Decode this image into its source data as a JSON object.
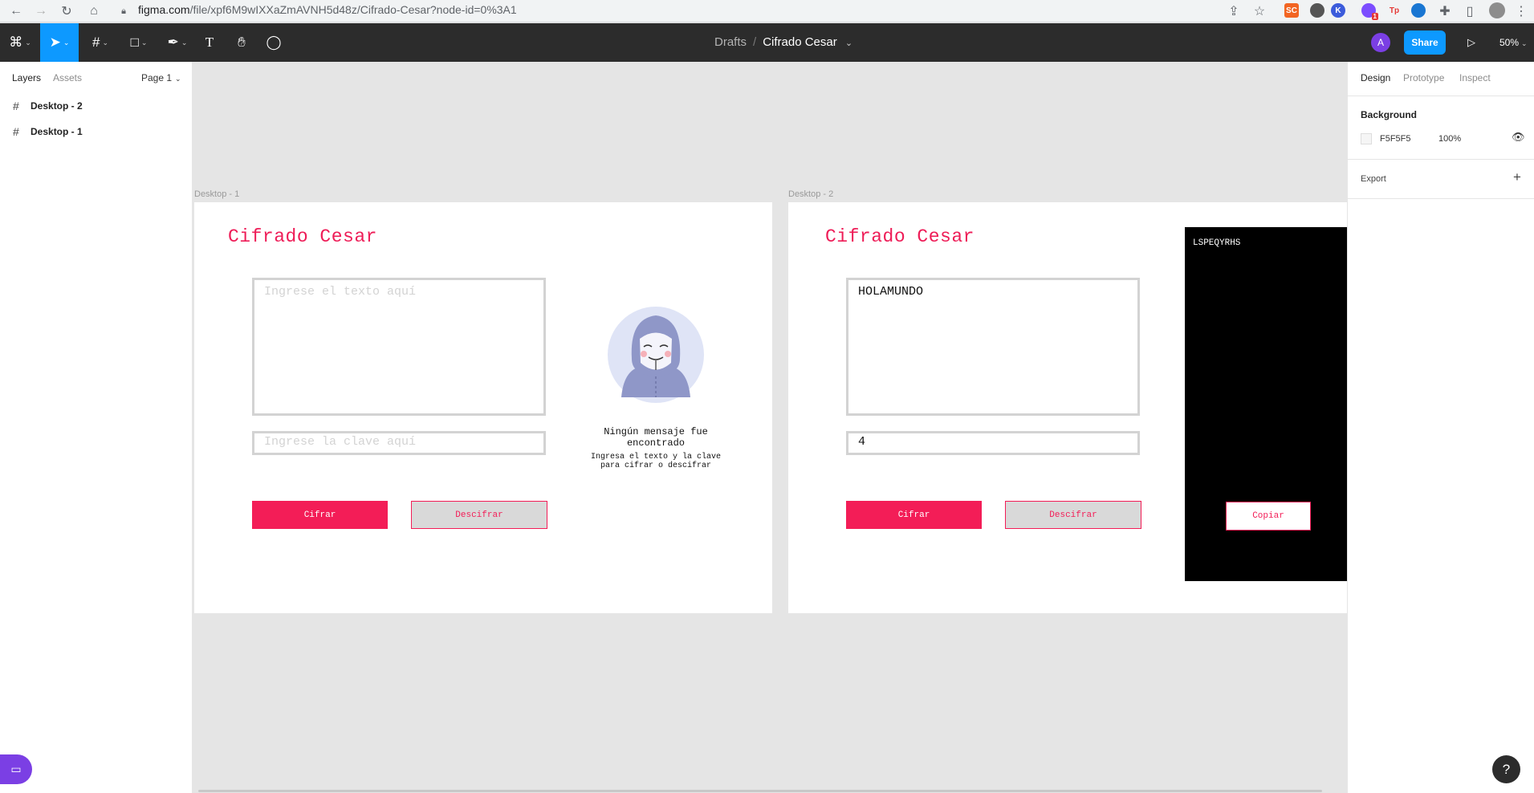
{
  "browser": {
    "url_host": "figma.com",
    "url_path": "/file/xpf6M9wIXXaZmAVNH5d48z/Cifrado-Cesar?node-id=0%3A1",
    "ext_sc": "SC",
    "ext_k": "K",
    "ext_badge": "1",
    "ext_tp": "Tp"
  },
  "toolbar": {
    "drafts": "Drafts",
    "separator": "/",
    "file_name": "Cifrado Cesar",
    "file_caret": "⌄",
    "avatar_initial": "A",
    "share_label": "Share",
    "zoom": "50%"
  },
  "left_panel": {
    "tab_layers": "Layers",
    "tab_assets": "Assets",
    "page_select": "Page 1",
    "layers": [
      {
        "label": "Desktop - 2"
      },
      {
        "label": "Desktop - 1"
      }
    ]
  },
  "right_panel": {
    "tab_design": "Design",
    "tab_prototype": "Prototype",
    "tab_inspect": "Inspect",
    "background_title": "Background",
    "background_color": "F5F5F5",
    "background_opacity": "100%",
    "export_title": "Export"
  },
  "canvas": {
    "frame1": {
      "label": "Desktop - 1",
      "title": "Cifrado Cesar",
      "text_placeholder": "Ingrese el texto aquí",
      "key_placeholder": "Ingrese la clave aquí",
      "cifrar": "Cifrar",
      "descifrar": "Descifrar",
      "msg_title": "Ningún mensaje fue encontrado",
      "msg_sub": "Ingresa el texto y la clave para cifrar o descifrar"
    },
    "frame2": {
      "label": "Desktop - 2",
      "title": "Cifrado Cesar",
      "text_value": "HOLAMUNDO",
      "key_value": "4",
      "cifrar": "Cifrar",
      "descifrar": "Descifrar",
      "result": "LSPEQYRHS",
      "copy": "Copiar"
    }
  },
  "colors": {
    "accent": "#f31d57",
    "figma_blue": "#0d99ff",
    "toolbar_bg": "#2c2c2c"
  },
  "help": "?"
}
